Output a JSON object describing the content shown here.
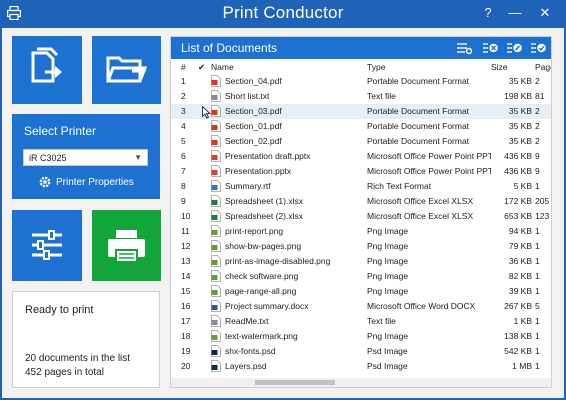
{
  "window": {
    "title": "Print Conductor",
    "help": "?",
    "minimize": "—",
    "close": "✕"
  },
  "sidebar": {
    "select_printer_label": "Select Printer",
    "printer_selected": "iR C3025",
    "printer_properties": "Printer Properties",
    "status_title": "Ready to print",
    "docs_summary": "20 documents in the list",
    "pages_summary": "452 pages in total"
  },
  "documents": {
    "title": "List of Documents",
    "columns": {
      "num": "#",
      "check": "✔",
      "name": "Name",
      "type": "Type",
      "size": "Size",
      "pages": "Pages"
    },
    "rows": [
      {
        "num": "1",
        "icon": "pdf-file-icon",
        "name": "Section_04.pdf",
        "type": "Portable Document Format",
        "size": "35 KB",
        "pages": "2"
      },
      {
        "num": "2",
        "icon": "text-file-icon",
        "name": "Short list.txt",
        "type": "Text file",
        "size": "198 KB",
        "pages": "81"
      },
      {
        "num": "3",
        "icon": "pdf-file-icon",
        "name": "Section_03.pdf",
        "type": "Portable Document Format",
        "size": "35 KB",
        "pages": "2"
      },
      {
        "num": "4",
        "icon": "pdf-file-icon",
        "name": "Section_01.pdf",
        "type": "Portable Document Format",
        "size": "35 KB",
        "pages": "2"
      },
      {
        "num": "5",
        "icon": "pdf-file-icon",
        "name": "Section_02.pdf",
        "type": "Portable Document Format",
        "size": "35 KB",
        "pages": "2"
      },
      {
        "num": "6",
        "icon": "powerpoint-file-icon",
        "name": "Presentation draft.pptx",
        "type": "Microsoft Office Power Point PPTX",
        "size": "436 KB",
        "pages": "9"
      },
      {
        "num": "7",
        "icon": "powerpoint-file-icon",
        "name": "Presentation.pptx",
        "type": "Microsoft Office Power Point PPTX",
        "size": "436 KB",
        "pages": "9"
      },
      {
        "num": "8",
        "icon": "rtf-file-icon",
        "name": "Summary.rtf",
        "type": "Rich Text Format",
        "size": "5 KB",
        "pages": "1"
      },
      {
        "num": "9",
        "icon": "excel-file-icon",
        "name": "Spreadsheet (1).xlsx",
        "type": "Microsoft Office Excel XLSX",
        "size": "172 KB",
        "pages": "205"
      },
      {
        "num": "10",
        "icon": "excel-file-icon",
        "name": "Spreadsheet (2).xlsx",
        "type": "Microsoft Office Excel XLSX",
        "size": "653 KB",
        "pages": "123"
      },
      {
        "num": "11",
        "icon": "png-file-icon",
        "name": "print-report.png",
        "type": "Png Image",
        "size": "94 KB",
        "pages": "1"
      },
      {
        "num": "12",
        "icon": "png-file-icon",
        "name": "show-bw-pages.png",
        "type": "Png Image",
        "size": "79 KB",
        "pages": "1"
      },
      {
        "num": "13",
        "icon": "png-file-icon",
        "name": "print-as-image-disabled.png",
        "type": "Png Image",
        "size": "36 KB",
        "pages": "1"
      },
      {
        "num": "14",
        "icon": "png-file-icon",
        "name": "check software.png",
        "type": "Png Image",
        "size": "82 KB",
        "pages": "1"
      },
      {
        "num": "15",
        "icon": "png-file-icon",
        "name": "page-range-all.png",
        "type": "Png Image",
        "size": "39 KB",
        "pages": "1"
      },
      {
        "num": "16",
        "icon": "word-file-icon",
        "name": "Project summary.docx",
        "type": "Microsoft Office Word DOCX",
        "size": "267 KB",
        "pages": "5"
      },
      {
        "num": "17",
        "icon": "text-file-icon",
        "name": "ReadMe.txt",
        "type": "Text file",
        "size": "1 KB",
        "pages": "1"
      },
      {
        "num": "18",
        "icon": "png-file-icon",
        "name": "text-watermark.png",
        "type": "Png Image",
        "size": "138 KB",
        "pages": "1"
      },
      {
        "num": "19",
        "icon": "psd-file-icon",
        "name": "shx-fonts.psd",
        "type": "Psd Image",
        "size": "542 KB",
        "pages": "1"
      },
      {
        "num": "20",
        "icon": "psd-file-icon",
        "name": "Layers.psd",
        "type": "Psd Image",
        "size": "1 MB",
        "pages": "1"
      }
    ],
    "selected_row": 3
  },
  "colors": {
    "titlebar": "#1e63b8",
    "tile_blue": "#1d72d1",
    "tile_green": "#12a53a",
    "selected_row": "#e6eef8"
  }
}
